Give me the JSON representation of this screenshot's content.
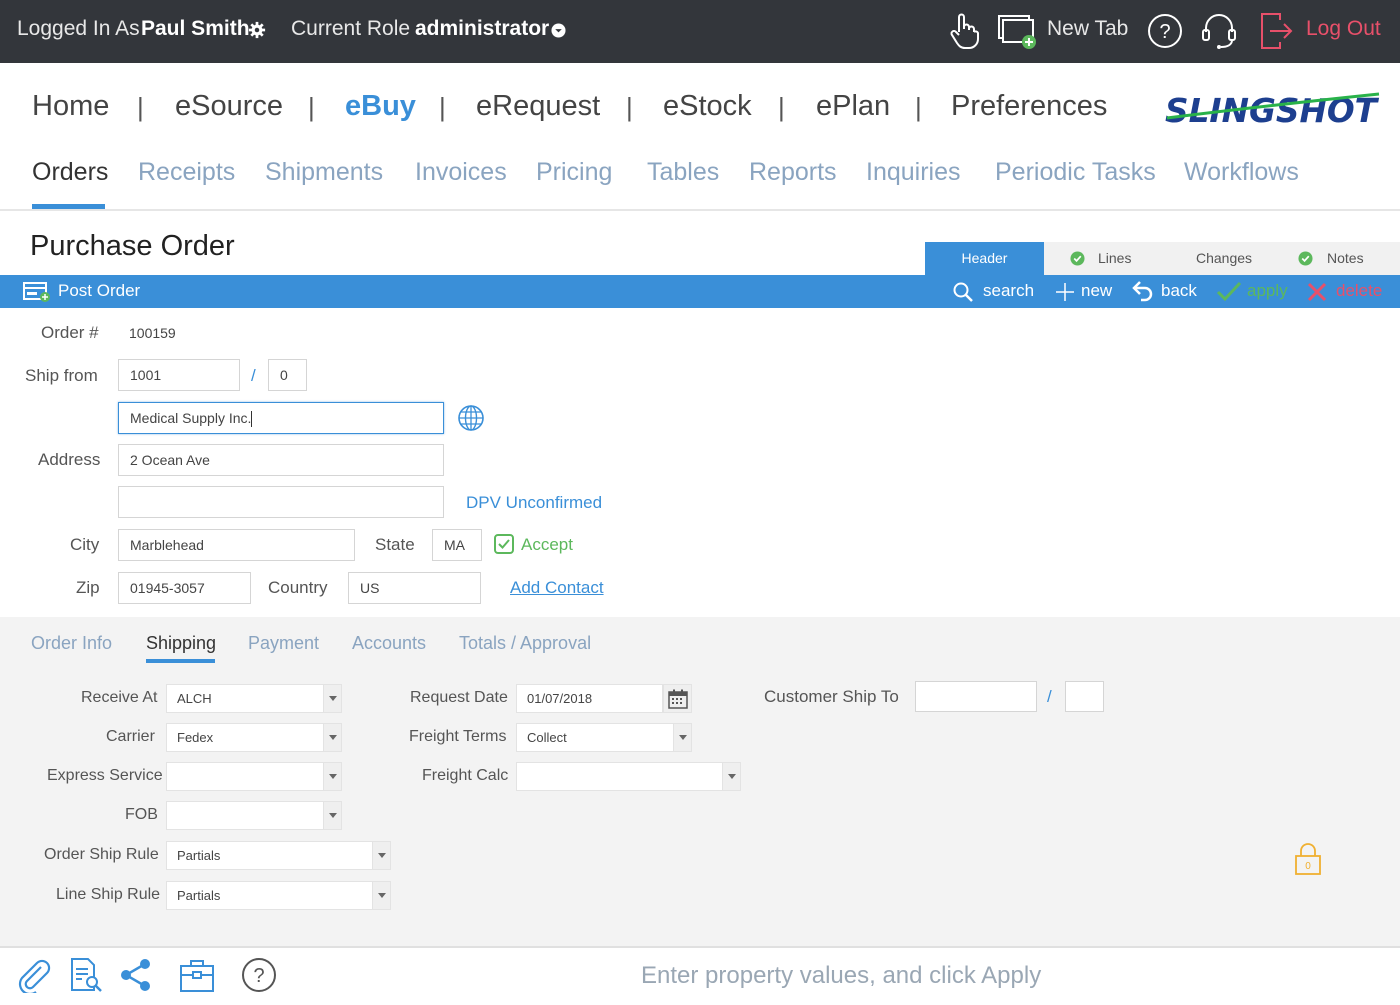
{
  "topbar": {
    "logged_in_label": "Logged In As",
    "user_name": "Paul Smith",
    "role_label": "Current Role",
    "role_value": "administrator",
    "new_tab_label": "New Tab",
    "logout_label": "Log Out"
  },
  "modules": [
    "Home",
    "eSource",
    "eBuy",
    "eRequest",
    "eStock",
    "ePlan",
    "Preferences"
  ],
  "modules_sep": "|",
  "brand": "SLINGSHOT",
  "subnav": [
    "Orders",
    "Receipts",
    "Shipments",
    "Invoices",
    "Pricing",
    "Tables",
    "Reports",
    "Inquiries",
    "Periodic Tasks",
    "Workflows"
  ],
  "page_title": "Purchase Order",
  "header_tabs": [
    "Header",
    "Lines",
    "Changes",
    "Notes"
  ],
  "actionbar": {
    "post_order": "Post Order",
    "search": "search",
    "new": "new",
    "back": "back",
    "apply": "apply",
    "delete": "delete"
  },
  "form": {
    "order_label": "Order #",
    "order_value": "100159",
    "ship_from_label": "Ship from",
    "ship_from_id": "1001",
    "ship_from_sep": "/",
    "ship_from_suffix": "0",
    "name_value": "Medical Supply Inc.",
    "address_label": "Address",
    "address_line1": "2 Ocean Ave",
    "address_line2": "",
    "dpv_label": "DPV Unconfirmed",
    "city_label": "City",
    "city_value": "Marblehead",
    "state_label": "State",
    "state_value": "MA",
    "accept_label": "Accept",
    "zip_label": "Zip",
    "zip_value": "01945-3057",
    "country_label": "Country",
    "country_value": "US",
    "add_contact": "Add Contact"
  },
  "lower_tabs": [
    "Order Info",
    "Shipping",
    "Payment",
    "Accounts",
    "Totals / Approval"
  ],
  "shipping": {
    "receive_at_label": "Receive At",
    "receive_at_value": "ALCH",
    "carrier_label": "Carrier",
    "carrier_value": "Fedex",
    "express_label": "Express Service",
    "express_value": "",
    "fob_label": "FOB",
    "fob_value": "",
    "order_ship_rule_label": "Order Ship Rule",
    "order_ship_rule_value": "Partials",
    "line_ship_rule_label": "Line Ship Rule",
    "line_ship_rule_value": "Partials",
    "request_date_label": "Request Date",
    "request_date_value": "01/07/2018",
    "freight_terms_label": "Freight Terms",
    "freight_terms_value": "Collect",
    "freight_calc_label": "Freight Calc",
    "freight_calc_value": "",
    "customer_ship_to_label": "Customer Ship To",
    "customer_ship_to_sep": "/",
    "lock_count": "0"
  },
  "status_message": "Enter property values, and click Apply",
  "colors": {
    "accent": "#3a8fd8",
    "topbar_bg": "#33363b",
    "success": "#5cb85c",
    "danger": "#e8506a",
    "lock": "#f0b030"
  }
}
